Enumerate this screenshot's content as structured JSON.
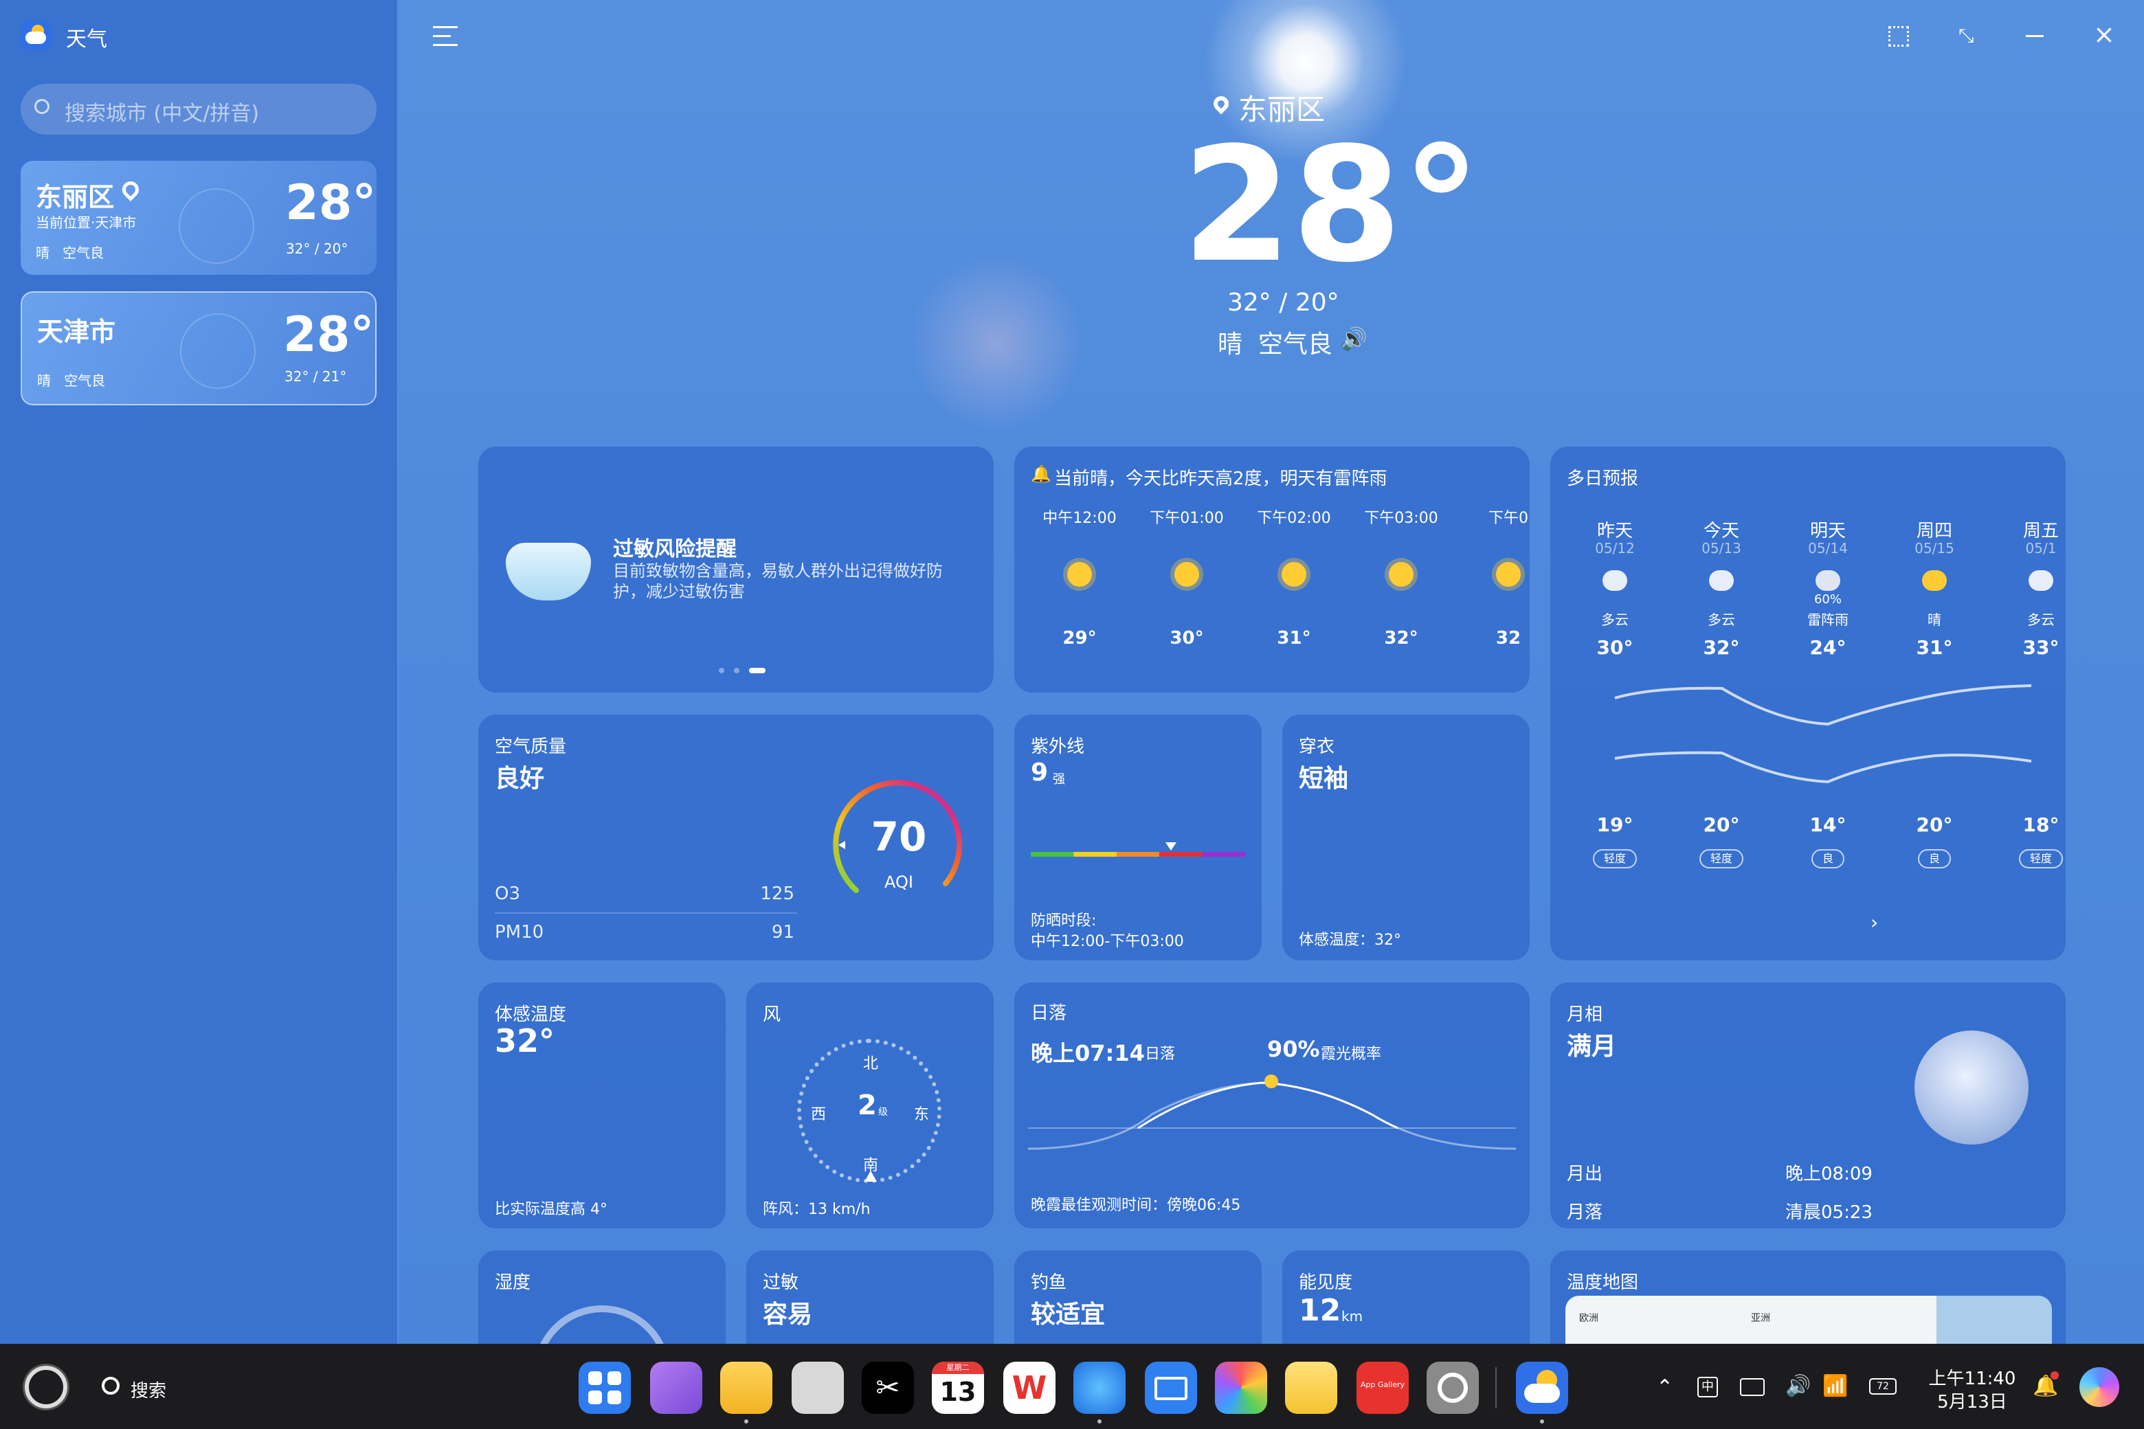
{
  "app": {
    "title": "天气",
    "search_placeholder": "搜索城市 (中文/拼音)"
  },
  "sidebar": {
    "cities": [
      {
        "name": "东丽区",
        "sub": "当前位置·天津市",
        "temp": "28°",
        "cond": "晴   空气良",
        "range": "32° / 20°"
      },
      {
        "name": "天津市",
        "sub": "",
        "temp": "28°",
        "cond": "晴   空气良",
        "range": "32° / 21°"
      }
    ]
  },
  "hero": {
    "location": "东丽区",
    "temp": "28°",
    "range": "32° / 20°",
    "cond": "晴  空气良"
  },
  "allergy": {
    "title": "过敏风险提醒",
    "desc": "目前致敏物含量高，易敏人群外出记得做好防护，减少过敏伤害"
  },
  "hourly": {
    "summary": "当前晴，今天比昨天高2度，明天有雷阵雨",
    "items": [
      {
        "time": "中午12:00",
        "temp": "29°"
      },
      {
        "time": "下午01:00",
        "temp": "30°"
      },
      {
        "time": "下午02:00",
        "temp": "31°"
      },
      {
        "time": "下午03:00",
        "temp": "32°"
      },
      {
        "time": "下午0",
        "temp": "32"
      }
    ]
  },
  "forecast": {
    "title": "多日预报",
    "days": [
      {
        "day": "昨天",
        "date": "05/12",
        "cond": "多云",
        "pop": "",
        "high": "30°",
        "low": "19°",
        "aq": "轻度",
        "icon": "partly-cloudy"
      },
      {
        "day": "今天",
        "date": "05/13",
        "cond": "多云",
        "pop": "",
        "high": "32°",
        "low": "20°",
        "aq": "轻度",
        "icon": "partly-cloudy"
      },
      {
        "day": "明天",
        "date": "05/14",
        "cond": "雷阵雨",
        "pop": "60%",
        "high": "24°",
        "low": "14°",
        "aq": "良",
        "icon": "thunderstorm"
      },
      {
        "day": "周四",
        "date": "05/15",
        "cond": "晴",
        "pop": "",
        "high": "31°",
        "low": "20°",
        "aq": "良",
        "icon": "sunny"
      },
      {
        "day": "周五",
        "date": "05/1",
        "cond": "多云",
        "pop": "",
        "high": "33°",
        "low": "18°",
        "aq": "轻度",
        "icon": "partly-cloudy"
      }
    ],
    "more": "›"
  },
  "air": {
    "label": "空气质量",
    "status": "良好",
    "rows": [
      {
        "name": "O3",
        "value": "125"
      },
      {
        "name": "PM10",
        "value": "91"
      }
    ],
    "aqi": "70",
    "aqi_label": "AQI",
    "aqi_value": 70
  },
  "uv": {
    "label": "紫外线",
    "value": "9",
    "level": "强",
    "period_label": "防晒时段:",
    "period": "中午12:00-下午03:00"
  },
  "clothing": {
    "label": "穿衣",
    "value": "短袖",
    "feel": "体感温度：32°"
  },
  "feels": {
    "label": "体感温度",
    "value": "32°",
    "note": "比实际温度高 4°"
  },
  "wind": {
    "label": "风",
    "level": "2",
    "unit": "级",
    "n": "北",
    "s": "南",
    "e": "东",
    "w": "西",
    "gust": "阵风：13 km/h"
  },
  "sunset": {
    "label": "日落",
    "time": "晚上07:14",
    "time_tag": "日落",
    "prob": "90%",
    "prob_tag": "霞光概率",
    "note": "晚霞最佳观测时间：傍晚06:45"
  },
  "moon": {
    "label": "月相",
    "phase": "满月",
    "rise_label": "月出",
    "rise": "晚上08:09",
    "set_label": "月落",
    "set": "清晨05:23"
  },
  "humidity": {
    "label": "湿度"
  },
  "allergy2": {
    "label": "过敏",
    "value": "容易"
  },
  "fishing": {
    "label": "钓鱼",
    "value": "较适宜"
  },
  "visibility": {
    "label": "能见度",
    "value": "12",
    "unit": "km"
  },
  "tempmap": {
    "label": "温度地图",
    "tag1": "欧洲",
    "tag2": "亚洲"
  },
  "taskbar": {
    "search": "搜索",
    "calendar_day": "13",
    "calendar_week": "星期二",
    "appgallery": "App Gallery",
    "ime": "中",
    "battery": "72",
    "time": "上午11:40",
    "date": "5月13日"
  },
  "colors": {
    "accent": "#3a72d0",
    "card": "rgba(38,92,196,.55)"
  }
}
